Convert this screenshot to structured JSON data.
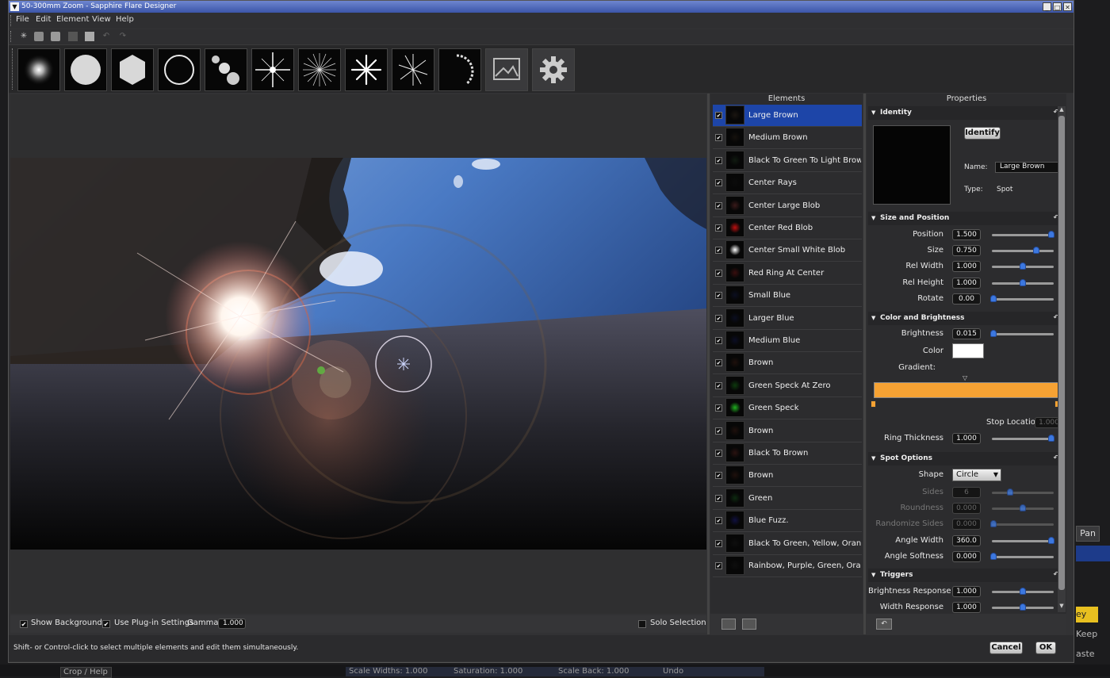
{
  "window": {
    "title": "50-300mm Zoom - Sapphire Flare Designer"
  },
  "menu": [
    "File",
    "Edit",
    "Element",
    "View",
    "Help"
  ],
  "element_types": [
    "glow",
    "disc",
    "hexagon",
    "ring",
    "multi-disc",
    "star",
    "sparkles",
    "rays",
    "streaks",
    "arc",
    "background",
    "settings"
  ],
  "viewport_bottom": {
    "show_background_label": "Show Background",
    "show_background_checked": true,
    "use_plugin_label": "Use Plug-in Settings",
    "use_plugin_checked": true,
    "gamma_label": "Gamma",
    "gamma_value": "1.000",
    "solo_label": "Solo Selection",
    "solo_checked": false
  },
  "elements_panel": {
    "header": "Elements",
    "items": [
      {
        "name": "Large Brown",
        "checked": true,
        "selected": true,
        "swatch": "#1a1510"
      },
      {
        "name": "Medium Brown",
        "checked": true,
        "swatch": "#15110d"
      },
      {
        "name": "Black To Green To Light Brown",
        "checked": true,
        "swatch": "#101a10"
      },
      {
        "name": "Center Rays",
        "checked": true,
        "swatch": "#0b0b0b"
      },
      {
        "name": "Center Large Blob",
        "checked": true,
        "swatch": "#3a1a1a"
      },
      {
        "name": "Center Red Blob",
        "checked": true,
        "swatch": "#c01010"
      },
      {
        "name": "Center Small White Blob",
        "checked": true,
        "swatch": "#ffffff"
      },
      {
        "name": "Red Ring At Center",
        "checked": true,
        "swatch": "#3a0e0e"
      },
      {
        "name": "Small Blue",
        "checked": true,
        "swatch": "#0b0e20"
      },
      {
        "name": "Larger Blue",
        "checked": true,
        "swatch": "#0b0e20"
      },
      {
        "name": "Medium Blue",
        "checked": true,
        "swatch": "#0b0d24"
      },
      {
        "name": "Brown",
        "checked": true,
        "swatch": "#1e100c"
      },
      {
        "name": "Green Speck At Zero",
        "checked": true,
        "swatch": "#0d3a0d"
      },
      {
        "name": "Green Speck",
        "checked": true,
        "swatch": "#20b020"
      },
      {
        "name": "Brown",
        "checked": true,
        "swatch": "#1e100c"
      },
      {
        "name": "Black To Brown",
        "checked": true,
        "swatch": "#2a1210"
      },
      {
        "name": "Brown",
        "checked": true,
        "swatch": "#1e100c"
      },
      {
        "name": "Green",
        "checked": true,
        "swatch": "#0d2a10"
      },
      {
        "name": "Blue Fuzz.",
        "checked": true,
        "swatch": "#101040"
      },
      {
        "name": "Black To Green, Yellow, Orange, ...",
        "checked": true,
        "swatch": "#0e0e0e"
      },
      {
        "name": "Rainbow, Purple, Green, Orange",
        "checked": true,
        "swatch": "#0e0e0e"
      }
    ]
  },
  "properties": {
    "header": "Properties",
    "identity": {
      "title": "Identity",
      "identify_button": "Identify",
      "name_label": "Name:",
      "name_value": "Large Brown",
      "type_label": "Type:",
      "type_value": "Spot"
    },
    "size_position": {
      "title": "Size and Position",
      "rows": [
        {
          "label": "Position",
          "value": "1.500",
          "level": 0.96,
          "enabled": true
        },
        {
          "label": "Size",
          "value": "0.750",
          "level": 0.72,
          "enabled": true
        },
        {
          "label": "Rel Width",
          "value": "1.000",
          "level": 0.5,
          "enabled": true
        },
        {
          "label": "Rel Height",
          "value": "1.000",
          "level": 0.5,
          "enabled": true
        },
        {
          "label": "Rotate",
          "value": "0.00",
          "level": 0.02,
          "enabled": true
        }
      ]
    },
    "color_brightness": {
      "title": "Color and Brightness",
      "brightness_label": "Brightness",
      "brightness_value": "0.015",
      "brightness_level": 0.03,
      "color_label": "Color",
      "color_value": "#ffffff",
      "gradient_label": "Gradient:",
      "gradient_color": "#f6a233",
      "stop_location_label": "Stop Location",
      "stop_location_value": "1.000",
      "ring_thickness_label": "Ring Thickness",
      "ring_thickness_value": "1.000",
      "ring_thickness_level": 0.96
    },
    "spot_options": {
      "title": "Spot Options",
      "shape_label": "Shape",
      "shape_value": "Circle",
      "rows": [
        {
          "label": "Sides",
          "value": "6",
          "level": 0.3,
          "enabled": false
        },
        {
          "label": "Roundness",
          "value": "0.000",
          "level": 0.5,
          "enabled": false
        },
        {
          "label": "Randomize Sides",
          "value": "0.000",
          "level": 0.02,
          "enabled": false
        },
        {
          "label": "Angle Width",
          "value": "360.0",
          "level": 0.96,
          "enabled": true
        },
        {
          "label": "Angle Softness",
          "value": "0.000",
          "level": 0.02,
          "enabled": true
        }
      ]
    },
    "triggers": {
      "title": "Triggers",
      "rows": [
        {
          "label": "Brightness Response",
          "value": "1.000",
          "level": 0.5,
          "enabled": true
        },
        {
          "label": "Width Response",
          "value": "1.000",
          "level": 0.5,
          "enabled": true
        }
      ]
    }
  },
  "status": {
    "hint": "Shift- or Control-click to select multiple elements and edit them simultaneously.",
    "cancel": "Cancel",
    "ok": "OK"
  },
  "background_app": {
    "pan": "Pan",
    "keep": "Keep",
    "paste": "aste",
    "ey": "ey",
    "bottom": [
      "Crop / Help",
      "Scale Widths: 1.000",
      "Saturation: 1.000",
      "Scale Back: 1.000",
      "Undo"
    ]
  },
  "colors": {
    "accent": "#1d45a8",
    "slider_knob": "#3c78e0",
    "title_bar": "#4a63b8"
  }
}
